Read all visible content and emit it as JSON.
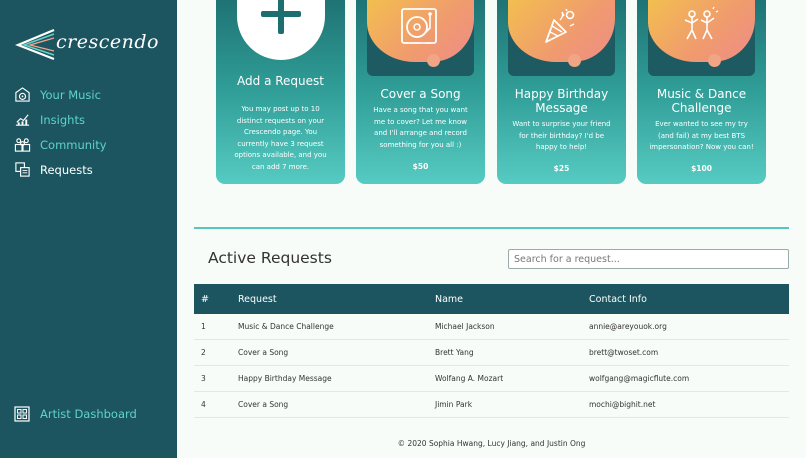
{
  "brand": {
    "logo_text": "crescendo"
  },
  "sidebar": {
    "items": [
      {
        "label": "Your Music",
        "icon": "vinyl-icon",
        "active": false
      },
      {
        "label": "Insights",
        "icon": "chart-icon",
        "active": false
      },
      {
        "label": "Community",
        "icon": "people-icon",
        "active": false
      },
      {
        "label": "Requests",
        "icon": "requests-icon",
        "active": true
      }
    ],
    "dashboard_label": "Artist Dashboard"
  },
  "cards": [
    {
      "title": "Add a Request",
      "description": "You may post up to 10 distinct requests on your Crescendo page. You currently have 3 request options available, and you can add 7 more.",
      "price": "",
      "icon": "plus-icon"
    },
    {
      "title": "Cover a Song",
      "description": "Have a song that you want me to cover? Let me know and I'll arrange and record something for you all :)",
      "price": "$50",
      "icon": "record-player-icon"
    },
    {
      "title": "Happy Birthday Message",
      "description": "Want to surprise your friend for their birthday? I'd be happy to help!",
      "price": "$25",
      "icon": "party-popper-icon"
    },
    {
      "title": "Music & Dance Challenge",
      "description": "Ever wanted to see my try (and fail) at my best BTS impersonation? Now you can!",
      "price": "$100",
      "icon": "dancers-icon"
    }
  ],
  "active_requests": {
    "title": "Active Requests",
    "search_placeholder": "Search for a request...",
    "columns": [
      "#",
      "Request",
      "Name",
      "Contact Info"
    ],
    "rows": [
      [
        "1",
        "Music & Dance Challenge",
        "Michael Jackson",
        "annie@areyouok.org"
      ],
      [
        "2",
        "Cover a Song",
        "Brett Yang",
        "brett@twoset.com"
      ],
      [
        "3",
        "Happy Birthday Message",
        "Wolfang A. Mozart",
        "wolfgang@magicflute.com"
      ],
      [
        "4",
        "Cover a Song",
        "Jimin Park",
        "mochi@bighit.net"
      ]
    ]
  },
  "footer": "© 2020 Sophia Hwang, Lucy Jiang, and Justin Ong",
  "colors": {
    "sidebar": "#1c5560",
    "accent": "#5fd3c8",
    "table_header": "#1c5560",
    "page_background": "#f8fcf8"
  }
}
